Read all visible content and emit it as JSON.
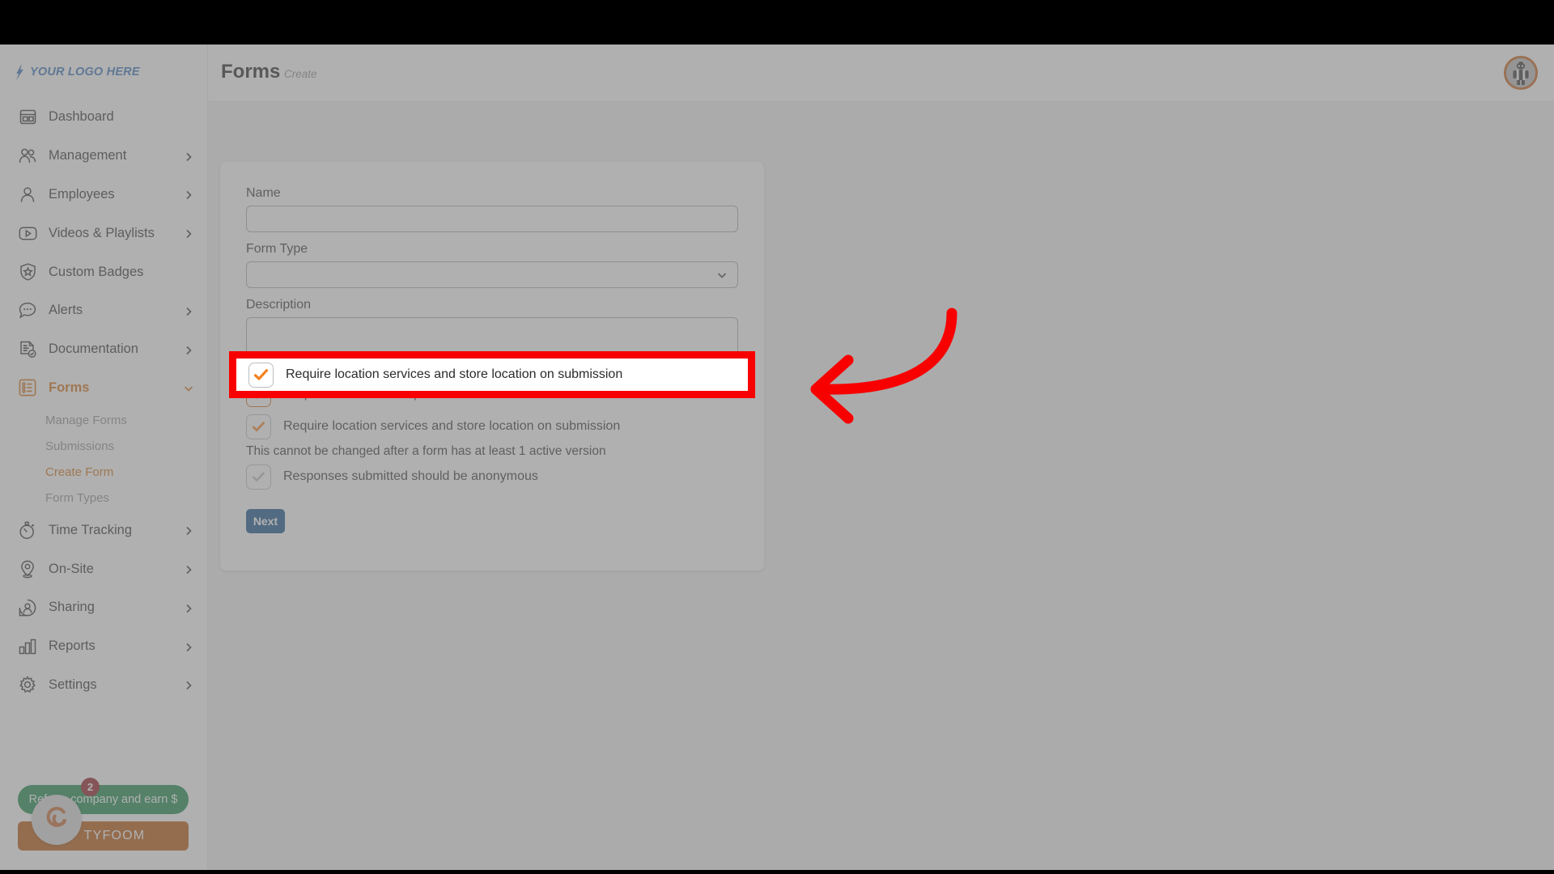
{
  "app": {
    "logo_text": "YOUR LOGO HERE",
    "logo_icon": "lightning-logo-icon"
  },
  "header": {
    "title": "Forms",
    "breadcrumb": "Create",
    "avatar_icon": "user-avatar"
  },
  "sidebar": {
    "items": [
      {
        "label": "Dashboard",
        "icon": "dashboard-icon",
        "expandable": false,
        "active": false
      },
      {
        "label": "Management",
        "icon": "people-icon",
        "expandable": true,
        "active": false
      },
      {
        "label": "Employees",
        "icon": "person-icon",
        "expandable": true,
        "active": false
      },
      {
        "label": "Videos & Playlists",
        "icon": "video-play-icon",
        "expandable": true,
        "active": false
      },
      {
        "label": "Custom Badges",
        "icon": "shield-star-icon",
        "expandable": false,
        "active": false
      },
      {
        "label": "Alerts",
        "icon": "chat-bubble-icon",
        "expandable": true,
        "active": false
      },
      {
        "label": "Documentation",
        "icon": "document-check-icon",
        "expandable": true,
        "active": false
      },
      {
        "label": "Forms",
        "icon": "form-list-icon",
        "expandable": true,
        "active": true
      },
      {
        "label": "Time Tracking",
        "icon": "stopwatch-icon",
        "expandable": true,
        "active": false
      },
      {
        "label": "On-Site",
        "icon": "map-pin-icon",
        "expandable": true,
        "active": false
      },
      {
        "label": "Sharing",
        "icon": "share-person-icon",
        "expandable": true,
        "active": false
      },
      {
        "label": "Reports",
        "icon": "bar-chart-icon",
        "expandable": true,
        "active": false
      },
      {
        "label": "Settings",
        "icon": "gear-icon",
        "expandable": true,
        "active": false
      }
    ],
    "forms_subitems": [
      {
        "label": "Manage Forms",
        "active": false
      },
      {
        "label": "Submissions",
        "active": false
      },
      {
        "label": "Create Form",
        "active": true
      },
      {
        "label": "Form Types",
        "active": false
      }
    ],
    "promo": {
      "refer_label": "Refer a company and earn $",
      "refer_badge": "2",
      "tyfoom_label": "TYFOOM",
      "fab_icon": "tyfoom-spiral-icon",
      "tyfoom_icon": "tyfoom-spiral-icon"
    }
  },
  "main": {
    "form": {
      "name_label": "Name",
      "name_value": "",
      "name_placeholder": "",
      "form_type_label": "Form Type",
      "form_type_value": "",
      "description_label": "Description",
      "description_value": "",
      "description_placeholder": "",
      "checkbox_job_location": {
        "label": "Require Job/Location question on submissions",
        "checked": true
      },
      "checkbox_location_services": {
        "label": "Require location services and store location on submission",
        "checked": true
      },
      "note": "This cannot be changed after a form has at least 1 active version",
      "checkbox_anonymous": {
        "label": "Responses submitted should be anonymous",
        "checked": true
      },
      "next_label": "Next"
    }
  },
  "annotation": {
    "highlight_color": "#f80000",
    "arrow_icon": "curved-left-arrow-annotation",
    "highlighted_label": "Require location services and store location on submission"
  },
  "colors": {
    "accent_orange": "#d2690a",
    "brand_blue": "#2f6cb5",
    "button_blue": "#0a4b86",
    "annotation_red": "#f80000",
    "refer_green": "#0f8343",
    "tyfoom_orange": "#b65000"
  }
}
